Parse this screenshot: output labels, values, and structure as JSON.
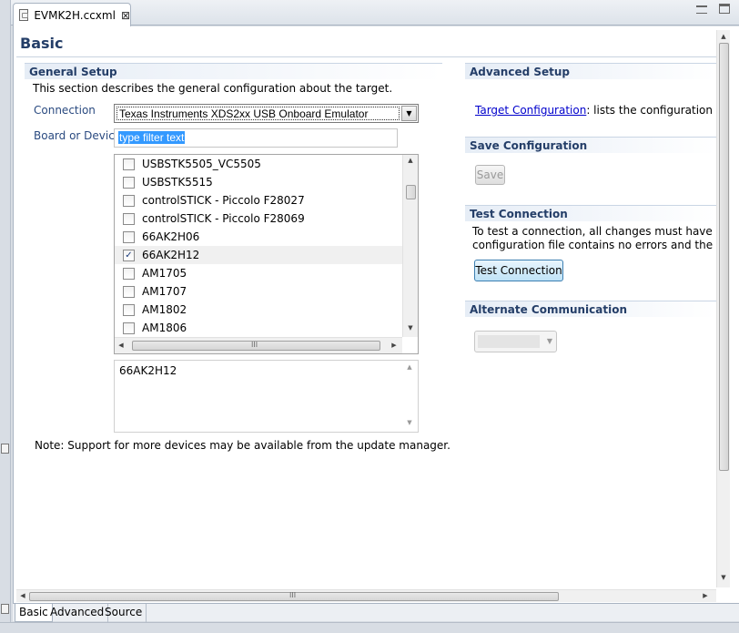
{
  "editor_tab": {
    "title": "EVMK2H.ccxml"
  },
  "page": {
    "title": "Basic"
  },
  "general_setup": {
    "header": "General Setup",
    "description": "This section describes the general configuration about the target.",
    "connection_label": "Connection",
    "connection_value": "Texas Instruments XDS2xx USB Onboard Emulator",
    "board_label": "Board or Device",
    "filter_placeholder": "type filter text",
    "devices": [
      {
        "label": "USBSTK5505_VC5505",
        "checked": false
      },
      {
        "label": "USBSTK5515",
        "checked": false
      },
      {
        "label": "controlSTICK - Piccolo F28027",
        "checked": false
      },
      {
        "label": "controlSTICK - Piccolo F28069",
        "checked": false
      },
      {
        "label": "66AK2H06",
        "checked": false
      },
      {
        "label": "66AK2H12",
        "checked": true
      },
      {
        "label": "AM1705",
        "checked": false
      },
      {
        "label": "AM1707",
        "checked": false
      },
      {
        "label": "AM1802",
        "checked": false
      },
      {
        "label": "AM1806",
        "checked": false
      }
    ],
    "selected_device": "66AK2H12",
    "note": "Note: Support for more devices may be available from the update manager."
  },
  "advanced_setup": {
    "header": "Advanced Setup",
    "link_text": "Target Configuration",
    "link_suffix": ": lists the configuration options"
  },
  "save_configuration": {
    "header": "Save Configuration",
    "button_label": "Save"
  },
  "test_connection": {
    "header": "Test Connection",
    "description_line1": "To test a connection, all changes must have been saved",
    "description_line2": "configuration file contains no errors and the connection",
    "button_label": "Test Connection"
  },
  "alternate_communication": {
    "header": "Alternate Communication",
    "selected_value": ""
  },
  "bottom_tabs": [
    {
      "label": "Basic",
      "active": true
    },
    {
      "label": "Advanced",
      "active": false
    },
    {
      "label": "Source",
      "active": false
    }
  ],
  "scroll_grip": "III",
  "edge_glyph": "≡",
  "colors": {
    "header_text": "#243e68",
    "link": "#0000cc",
    "selection": "#3399ff",
    "test_button": "#bfe3f7"
  },
  "icons": [
    "file-icon",
    "close-icon",
    "minimize-icon",
    "maximize-icon",
    "checkbox-check-icon",
    "dropdown-arrow-icon"
  ]
}
